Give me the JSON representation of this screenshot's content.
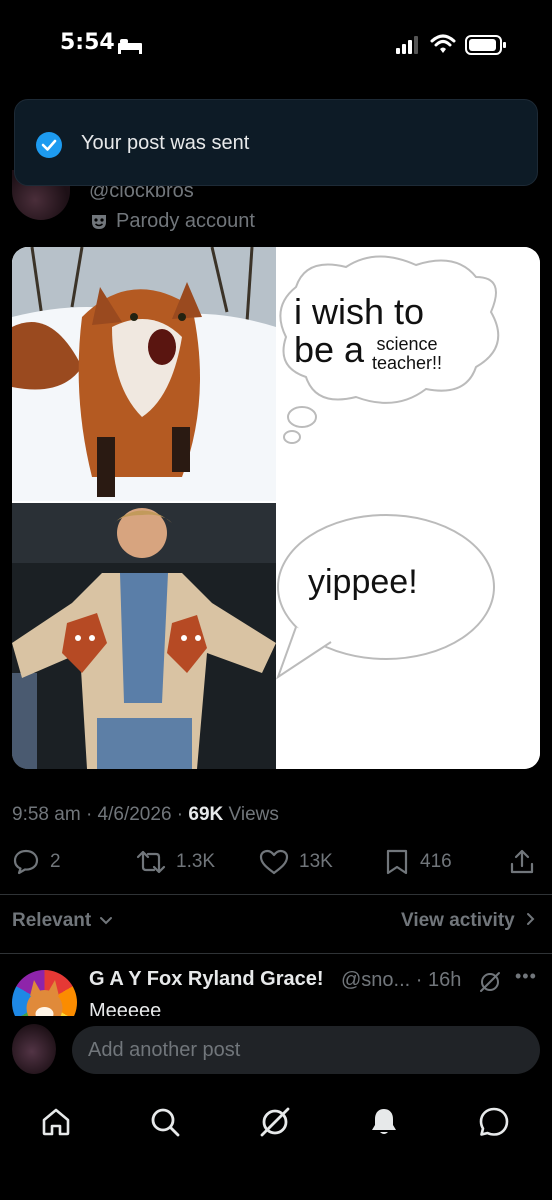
{
  "status_bar": {
    "time": "5:54"
  },
  "toast": {
    "message": "Your post was sent"
  },
  "post": {
    "handle": "@clockbros",
    "account_label": "Parody account",
    "image_text": {
      "bubble_1_line": "i wish to",
      "bubble_1_be": "be a",
      "bubble_1_small": "science\nteacher!!",
      "bubble_2": "yippee!"
    },
    "time": "9:58 am",
    "date": "4/6/2026",
    "views_count": "69K",
    "views_label": "Views",
    "actions": {
      "replies": "2",
      "reposts": "1.3K",
      "likes": "13K",
      "bookmarks": "416"
    }
  },
  "replies_header": {
    "sort_label": "Relevant",
    "view_activity": "View activity"
  },
  "reply": {
    "name": "G A Y Fox Ryland Grace!",
    "handle_time": "@sno... · 16h",
    "text": "Meeeee"
  },
  "compose": {
    "placeholder": "Add another post"
  },
  "colors": {
    "accent": "#1d9bf0",
    "muted": "#71767b",
    "text": "#e7e9ea",
    "background": "#000000"
  }
}
